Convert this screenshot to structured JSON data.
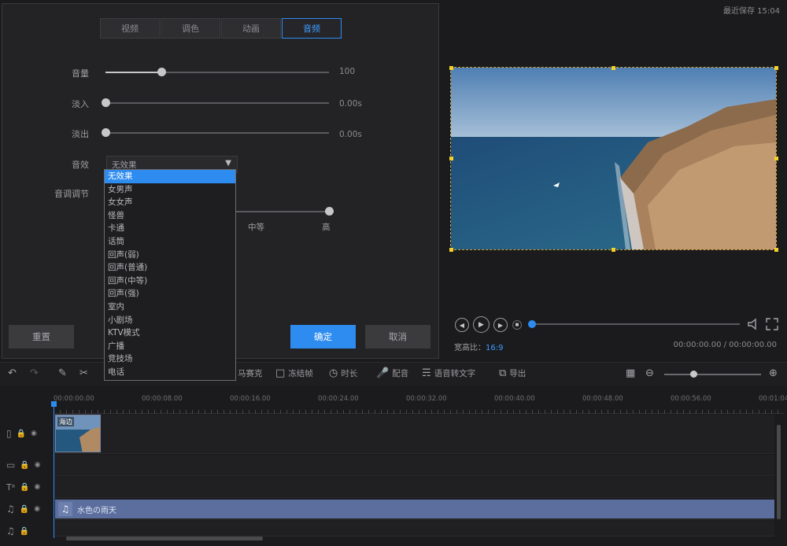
{
  "tabs": [
    "视频",
    "调色",
    "动画",
    "音频"
  ],
  "active_tab": 3,
  "settings": {
    "volume": {
      "label": "音量",
      "value": "100",
      "level": 0.25
    },
    "fade_in": {
      "label": "淡入",
      "value": "0.00s",
      "level": 0
    },
    "fade_out": {
      "label": "淡出",
      "value": "0.00s",
      "level": 0
    },
    "effect": {
      "label": "音效",
      "selected": "无效果"
    },
    "voice_change": {
      "label": "音调调节",
      "mid_label": "中等",
      "high_label": "高",
      "level": 1.0
    }
  },
  "effect_options": [
    "无效果",
    "女男声",
    "女女声",
    "怪兽",
    "卡通",
    "话筒",
    "回声(弱)",
    "回声(普通)",
    "回声(中等)",
    "回声(强)",
    "室内",
    "小剧场",
    "KTV模式",
    "广播",
    "竞技场",
    "电话"
  ],
  "effect_highlighted": 0,
  "buttons": {
    "reset": "重置",
    "confirm": "确定",
    "cancel": "取消"
  },
  "preview": {
    "saved_label": "最近保存 15:04",
    "aspect_label": "宽高比：",
    "aspect_value": "16:9",
    "time": "00:00:00.00 / 00:00:00.00",
    "progress": 0.0
  },
  "toolbar": {
    "tools": [
      "马赛克",
      "冻结帧",
      "时长",
      "配音",
      "语音转文字",
      "导出"
    ],
    "zoom_level": 0.3
  },
  "timeline": {
    "ticks": [
      "00:00:00.00",
      "00:00:08.00",
      "00:00:16.00",
      "00:00:24.00",
      "00:00:32.00",
      "00:00:40.00",
      "00:00:48.00",
      "00:00:56.00",
      "00:01:04"
    ],
    "video_clip_label": "海边",
    "audio_clip_label": "水色の雨天"
  },
  "colors": {
    "accent": "#2e8cf0",
    "audio_clip": "#5b6e9e",
    "panel": "#232325",
    "background": "#1b1b1d"
  }
}
